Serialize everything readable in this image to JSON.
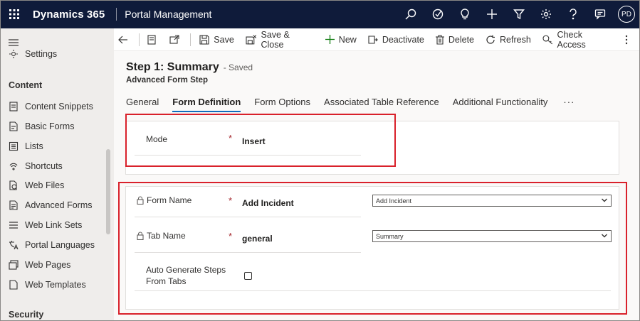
{
  "topbar": {
    "brand": "Dynamics 365",
    "app_name": "Portal Management",
    "avatar_initials": "PD",
    "icons": [
      "search-icon",
      "task-icon",
      "lightbulb-icon",
      "plus-icon",
      "filter-icon",
      "gear-icon",
      "help-icon",
      "chat-icon"
    ]
  },
  "sidebar": {
    "partial_item": "Settings",
    "section_content": "Content",
    "items": [
      {
        "label": "Content Snippets",
        "icon": "snippet-icon"
      },
      {
        "label": "Basic Forms",
        "icon": "form-icon"
      },
      {
        "label": "Lists",
        "icon": "list-icon"
      },
      {
        "label": "Shortcuts",
        "icon": "shortcut-icon"
      },
      {
        "label": "Web Files",
        "icon": "web-file-icon"
      },
      {
        "label": "Advanced Forms",
        "icon": "advanced-form-icon"
      },
      {
        "label": "Web Link Sets",
        "icon": "link-set-icon"
      },
      {
        "label": "Portal Languages",
        "icon": "language-icon"
      },
      {
        "label": "Web Pages",
        "icon": "web-page-icon"
      },
      {
        "label": "Web Templates",
        "icon": "template-icon"
      }
    ],
    "section_security": "Security"
  },
  "commandbar": {
    "save": "Save",
    "save_close": "Save & Close",
    "new": "New",
    "deactivate": "Deactivate",
    "delete": "Delete",
    "refresh": "Refresh",
    "check_access": "Check Access"
  },
  "record": {
    "title": "Step 1: Summary",
    "status": "- Saved",
    "entity": "Advanced Form Step"
  },
  "tabs": [
    "General",
    "Form Definition",
    "Form Options",
    "Associated Table Reference",
    "Additional Functionality"
  ],
  "tabs_more": "···",
  "active_tab": "Form Definition",
  "form": {
    "mode": {
      "label": "Mode",
      "required": "*",
      "value": "Insert"
    },
    "form_name": {
      "label": "Form Name",
      "required": "*",
      "value": "Add Incident",
      "select_value": "Add Incident"
    },
    "tab_name": {
      "label": "Tab Name",
      "required": "*",
      "value": "general",
      "select_value": "Summary"
    },
    "auto_generate": {
      "label_line1": "Auto Generate Steps",
      "label_line2": "From Tabs",
      "checked": false
    }
  },
  "colors": {
    "topbar": "#0f1b3a",
    "accent": "#0f6cbd",
    "highlight": "#d9212b",
    "required": "#a4262c"
  }
}
